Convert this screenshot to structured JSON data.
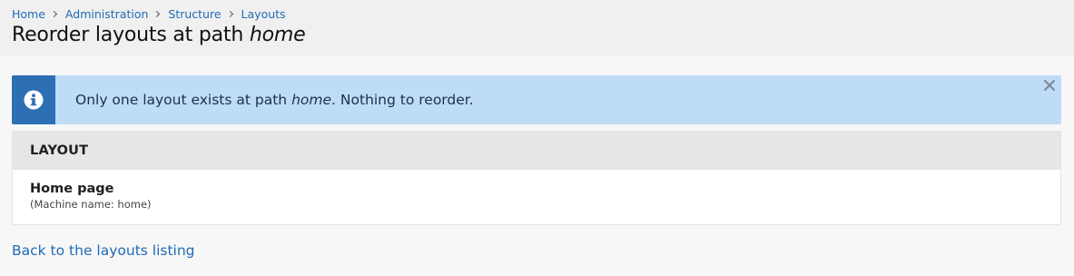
{
  "breadcrumb": {
    "items": [
      "Home",
      "Administration",
      "Structure",
      "Layouts"
    ]
  },
  "page_title": {
    "prefix": "Reorder layouts at path ",
    "path": "home"
  },
  "message": {
    "icon": "info-icon",
    "text_before": "Only one layout exists at path ",
    "path": "home",
    "text_after": ". Nothing to reorder.",
    "close_icon": "close-icon"
  },
  "table": {
    "header": "LAYOUT",
    "rows": [
      {
        "name": "Home page",
        "machine": "(Machine name: home)"
      }
    ]
  },
  "back_link": "Back to the layouts listing",
  "colors": {
    "link": "#1f6bb5",
    "message_bg": "#bfdcf7",
    "message_icon_bg": "#2d6fb4",
    "header_bg": "#f0f0f0",
    "table_header_bg": "#e6e6e6"
  }
}
